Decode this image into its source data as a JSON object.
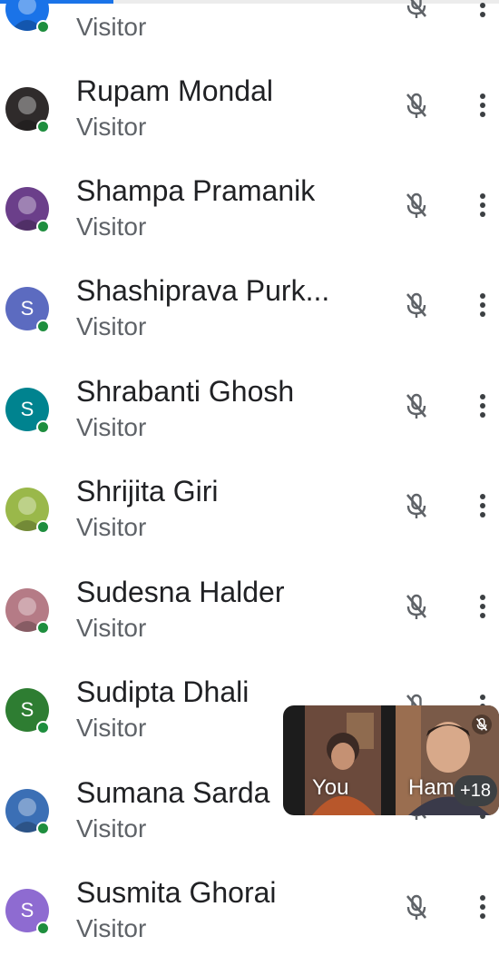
{
  "participants": [
    {
      "name": "",
      "role": "Visitor",
      "avatar_color": "#1a73e8"
    },
    {
      "name": "Rupam Mondal",
      "role": "Visitor",
      "avatar_color": "#2f2b2b"
    },
    {
      "name": "Shampa Pramanik",
      "role": "Visitor",
      "avatar_color": "#6b3f8a"
    },
    {
      "name": "Shashiprava Purk...",
      "role": "Visitor",
      "avatar_color": "#5c6bc0",
      "initial": "S"
    },
    {
      "name": "Shrabanti Ghosh",
      "role": "Visitor",
      "avatar_color": "#00838f",
      "initial": "S"
    },
    {
      "name": "Shrijita Giri",
      "role": "Visitor",
      "avatar_color": "#9ab84a"
    },
    {
      "name": "Sudesna Halder",
      "role": "Visitor",
      "avatar_color": "#b57b86"
    },
    {
      "name": "Sudipta Dhali",
      "role": "Visitor",
      "avatar_color": "#2e7d32",
      "initial": "S"
    },
    {
      "name": "Sumana Sarda",
      "role": "Visitor",
      "avatar_color": "#3b6fb5"
    },
    {
      "name": "Susmita Ghorai",
      "role": "Visitor",
      "avatar_color": "#8e6bd1",
      "initial": "S"
    }
  ],
  "call_preview": {
    "you_label": "You",
    "other_label": "Ham",
    "extra_count": "+18"
  },
  "icons": {
    "mic": "mic-off-icon",
    "more": "more-vert-icon"
  }
}
